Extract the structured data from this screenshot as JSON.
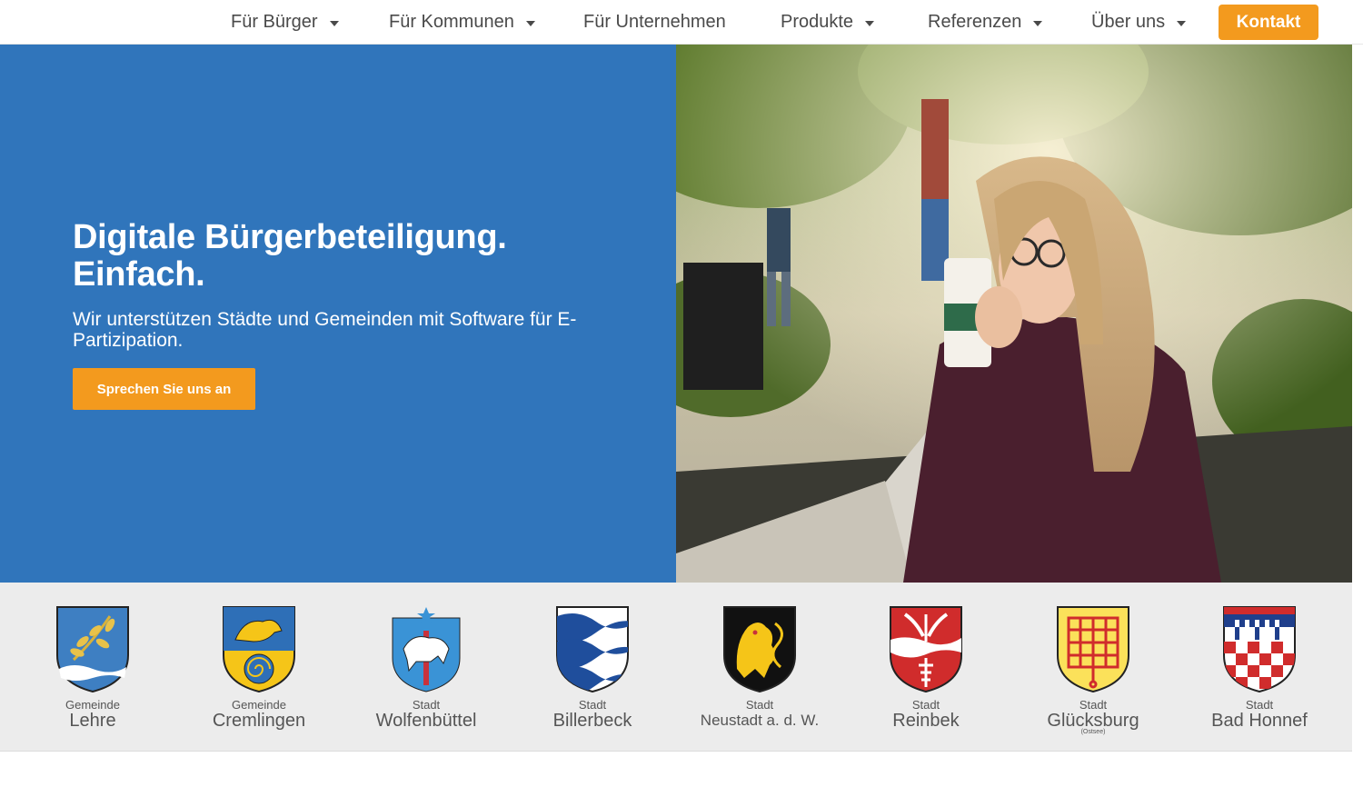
{
  "nav": {
    "items": [
      {
        "label": "Für Bürger",
        "dropdown": true
      },
      {
        "label": "Für Kommunen",
        "dropdown": true
      },
      {
        "label": "Für Unternehmen",
        "dropdown": false
      },
      {
        "label": "Produkte",
        "dropdown": true
      },
      {
        "label": "Referenzen",
        "dropdown": true
      },
      {
        "label": "Über uns",
        "dropdown": true
      }
    ],
    "cta_label": "Kontakt"
  },
  "hero": {
    "title_line1": "Digitale Bürgerbeteiligung.",
    "title_line2": "Einfach.",
    "subtitle": "Wir unterstützen Städte und Gemeinden mit Software für E-Partizipation.",
    "cta_label": "Sprechen Sie uns an"
  },
  "references": [
    {
      "kind": "Gemeinde",
      "name": "Lehre",
      "extra": ""
    },
    {
      "kind": "Gemeinde",
      "name": "Cremlingen",
      "extra": ""
    },
    {
      "kind": "Stadt",
      "name": "Wolfenbüttel",
      "extra": ""
    },
    {
      "kind": "Stadt",
      "name": "Billerbeck",
      "extra": ""
    },
    {
      "kind": "Stadt",
      "name": "Neustadt a. d. W.",
      "extra": ""
    },
    {
      "kind": "Stadt",
      "name": "Reinbek",
      "extra": ""
    },
    {
      "kind": "Stadt",
      "name": "Glücksburg",
      "extra": "(Ostsee)"
    },
    {
      "kind": "Stadt",
      "name": "Bad Honnef",
      "extra": ""
    }
  ],
  "colors": {
    "hero_blue": "#3075bb",
    "accent_orange": "#f39a1e",
    "nav_text": "#4a4a4a",
    "strip_bg": "#ececec"
  }
}
